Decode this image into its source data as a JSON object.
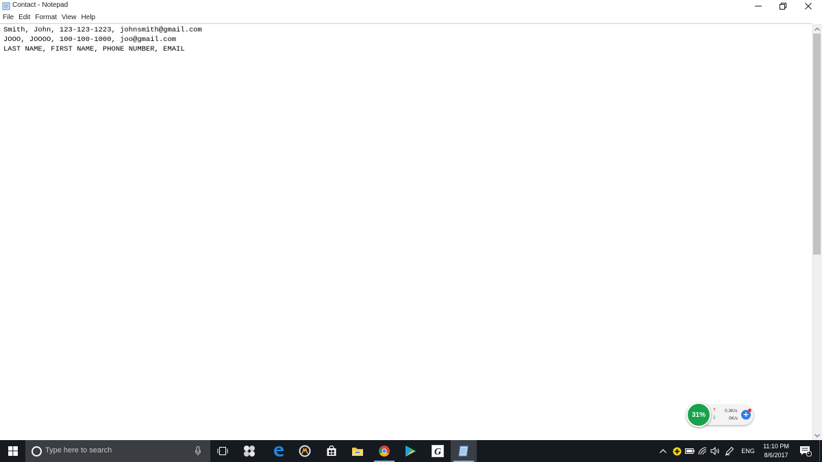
{
  "window": {
    "title": "Contact - Notepad"
  },
  "menu": [
    "File",
    "Edit",
    "Format",
    "View",
    "Help"
  ],
  "editor": {
    "lines": [
      "Smith, John, 123-123-1223, johnsmith@gmail.com",
      "JOOO, JOOOO, 100-100-1000, joo@gmail.com",
      "LAST NAME, FIRST NAME, PHONE NUMBER, EMAIL"
    ]
  },
  "net_widget": {
    "percent": "31%",
    "upload": "0.3K/s",
    "download": "0K/s"
  },
  "taskbar": {
    "search_placeholder": "Type here to search",
    "pinned": [
      "task-view",
      "pinwheel-app",
      "edge",
      "overwatch",
      "store",
      "file-explorer",
      "chrome",
      "media-player",
      "g-app",
      "notepad"
    ],
    "language": "ENG",
    "time": "11:10 PM",
    "date": "8/6/2017",
    "notifications": "1"
  },
  "colors": {
    "taskbar_bg": "#151a21",
    "search_bg": "#3a3d42",
    "widget_green": "#18a24b",
    "accent_blue": "#7fb4e6"
  }
}
